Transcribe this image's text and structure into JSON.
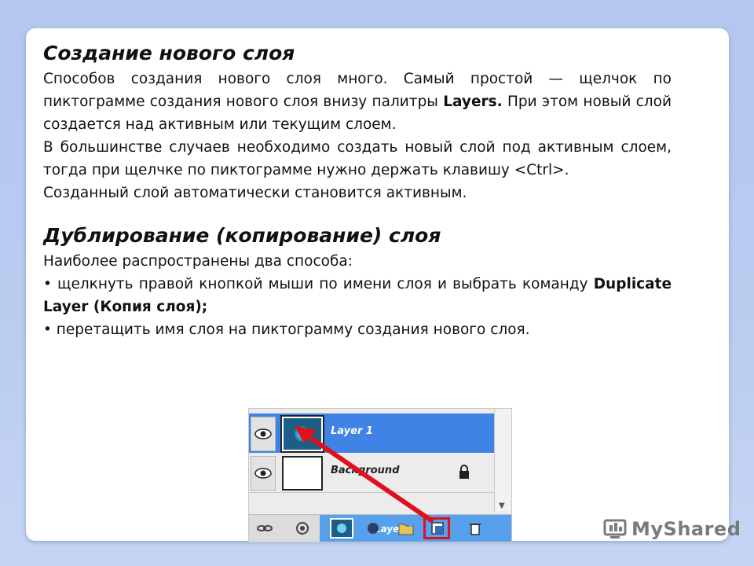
{
  "section1": {
    "title": "Создание нового слоя",
    "p1_text": "Способов создания нового слоя много. Самый простой — щелчок по пиктограмме создания нового слоя внизу палитры ",
    "p1_bold": "Layers.",
    "p1_tail": " При этом новый слой создается над активным или текущим слоем.",
    "p2": "В большинстве случаев необходимо создать новый слой под активным слоем, тогда при щелчке по пиктограмме нужно держать клавишу <Ctrl>.",
    "p3": "Созданный слой автоматически становится активным."
  },
  "section2": {
    "title": "Дублирование (копирование) слоя",
    "intro": "Наиболее распространены два способа:",
    "bullet1_text": "• щелкнуть правой кнопкой мыши по имени слоя и выбрать команду ",
    "bullet1_bold": "Duplicate Layer (Копия слоя);",
    "bullet2": "• перетащить имя слоя на пиктограмму создания нового слоя."
  },
  "layers_panel": {
    "layers": [
      {
        "name": "Layer 1",
        "selected": true
      },
      {
        "name": "Background",
        "locked": true
      }
    ],
    "ghost_label": "Layer 1",
    "highlight_color": "#e0101c"
  },
  "logo": {
    "text": "MyShared"
  }
}
